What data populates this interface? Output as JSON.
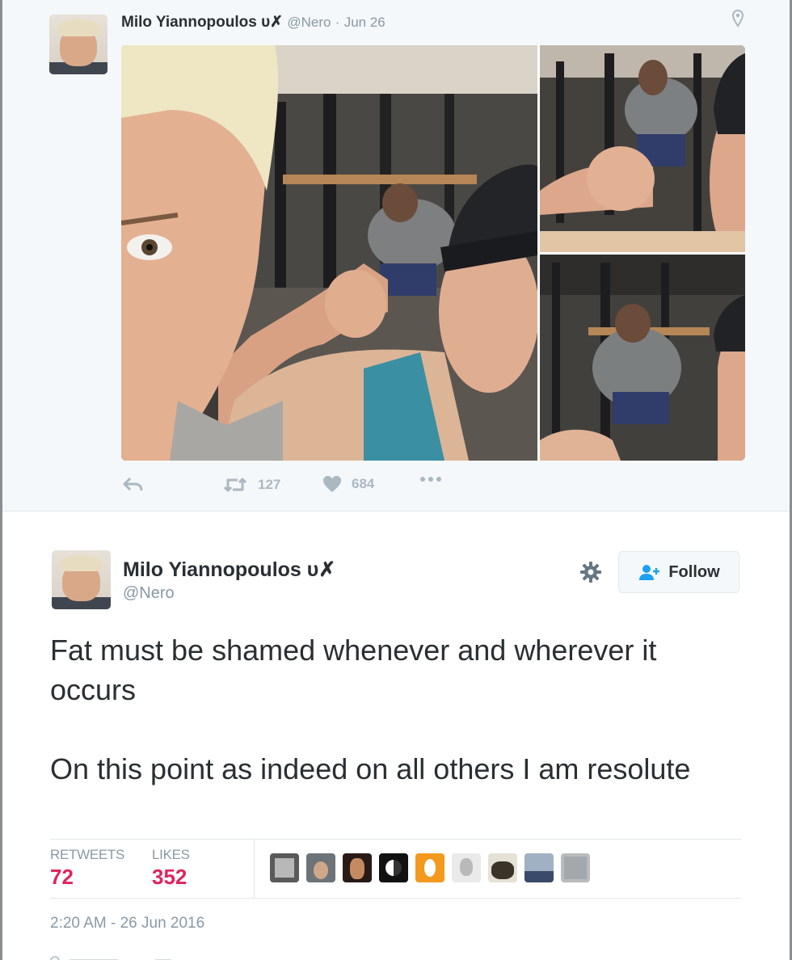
{
  "parent_tweet": {
    "name": "Milo Yiannopoulos ᴜ✗",
    "handle": "@Nero",
    "separator": "·",
    "date": "Jun 26",
    "retweets": "127",
    "likes": "684"
  },
  "tweet": {
    "name": "Milo Yiannopoulos ᴜ✗",
    "handle": "@Nero",
    "follow_label": "Follow",
    "text_para1": "Fat must be shamed whenever and wherever it occurs",
    "text_para2": "On this point as indeed on all others I am resolute",
    "retweets_label": "RETWEETS",
    "retweets_count": "72",
    "likes_label": "LIKES",
    "likes_count": "352",
    "timestamp": "2:20 AM - 26 Jun 2016"
  },
  "colors": {
    "link_blue": "#1da1f2",
    "stat_red": "#e0245e",
    "muted_gray": "#8899a6",
    "icon_gray": "#aab8c2"
  },
  "icons": [
    "location-pin-icon",
    "reply-icon",
    "retweet-icon",
    "heart-icon",
    "more-icon",
    "gear-icon",
    "follow-person-icon"
  ]
}
